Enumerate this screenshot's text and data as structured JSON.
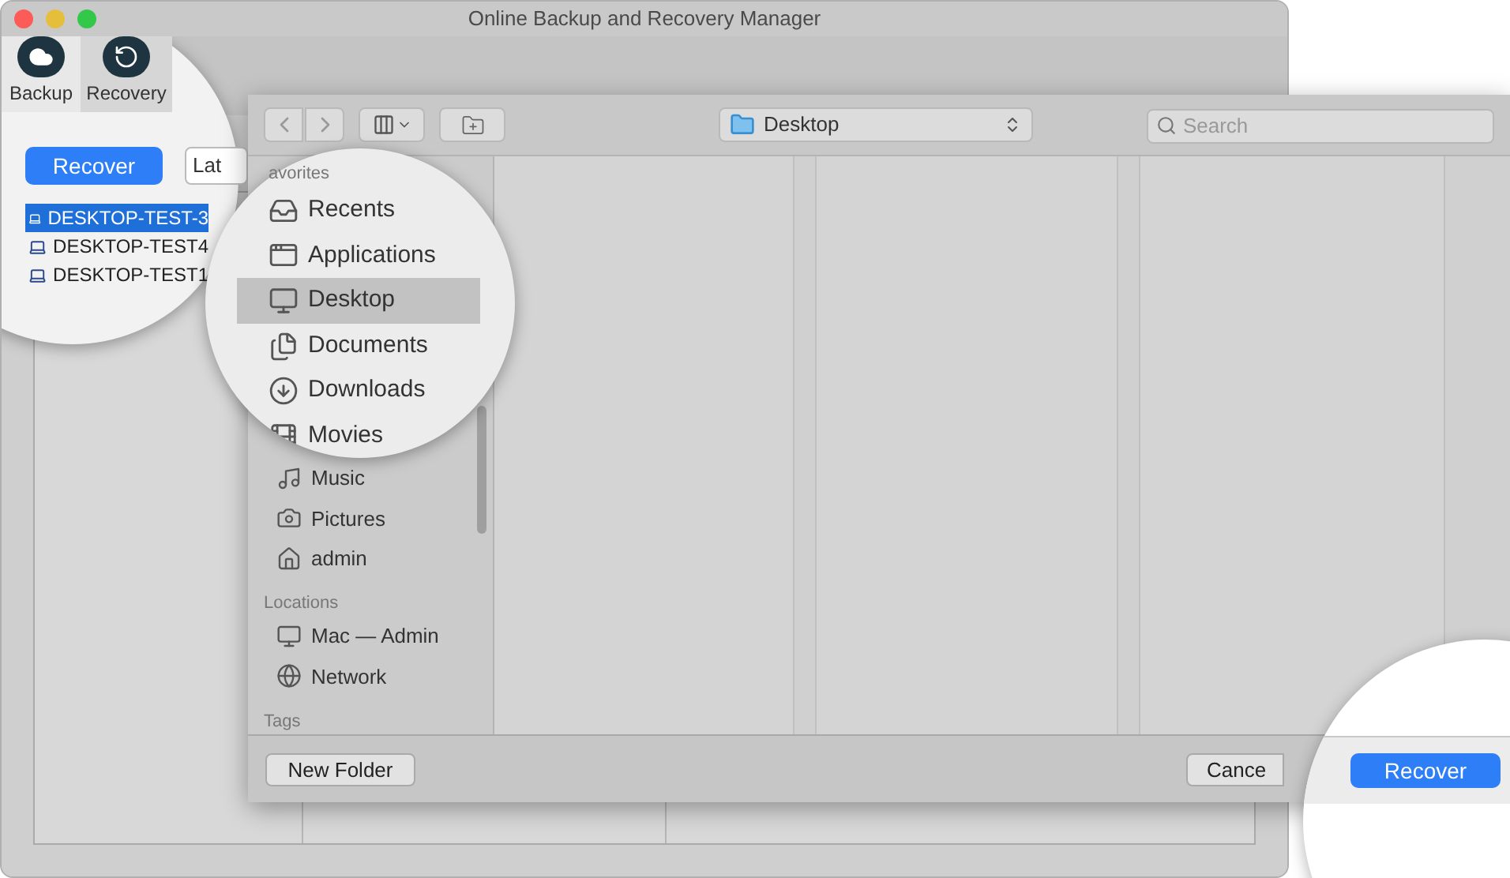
{
  "window": {
    "title": "Online Backup and Recovery Manager"
  },
  "tabs": [
    {
      "label": "Backup",
      "selected": false
    },
    {
      "label": "Recovery",
      "selected": true
    }
  ],
  "recover_button": "Recover",
  "filter_field": {
    "value": "Lat"
  },
  "computers": [
    {
      "name": "DESKTOP-TEST-3",
      "selected": true
    },
    {
      "name": "DESKTOP-TEST4",
      "selected": false
    },
    {
      "name": "DESKTOP-TEST1",
      "selected": false
    }
  ],
  "dialog": {
    "location": "Desktop",
    "search": {
      "placeholder": "Search"
    },
    "sidebar": {
      "favorites_heading": "avorites",
      "magnified_items": [
        {
          "label": "Recents",
          "kind": "recents",
          "selected": false
        },
        {
          "label": "Applications",
          "kind": "applications",
          "selected": false
        },
        {
          "label": "Desktop",
          "kind": "desktop",
          "selected": true
        },
        {
          "label": "Documents",
          "kind": "documents",
          "selected": false
        },
        {
          "label": "Downloads",
          "kind": "downloads",
          "selected": false
        },
        {
          "label": "Movies",
          "kind": "movies",
          "selected": false
        }
      ],
      "items": [
        {
          "label": "Music",
          "kind": "music",
          "selected": false
        },
        {
          "label": "Pictures",
          "kind": "pictures",
          "selected": false
        },
        {
          "label": "admin",
          "kind": "home",
          "selected": false
        }
      ],
      "locations_heading": "Locations",
      "locations": [
        {
          "label": "Mac — Admin",
          "kind": "computer",
          "selected": false
        },
        {
          "label": "Network",
          "kind": "network",
          "selected": false
        }
      ],
      "tags_heading": "Tags"
    },
    "buttons": {
      "new_folder": "New Folder",
      "cancel": "Cance",
      "confirm": "Recover"
    }
  }
}
